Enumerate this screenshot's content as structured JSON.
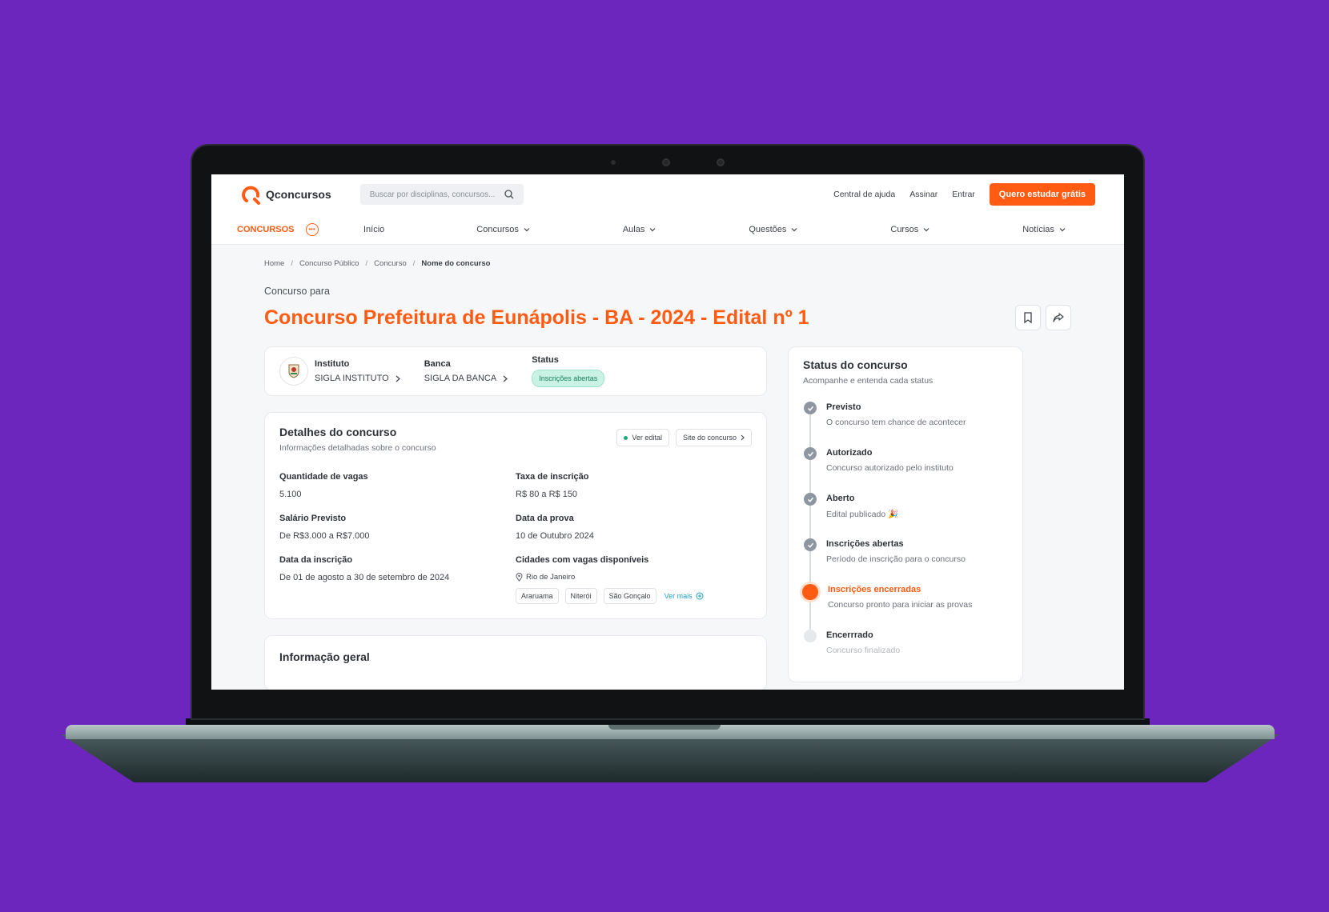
{
  "header": {
    "logo_text": "Qconcursos",
    "search_placeholder": "Buscar por disciplinas, concursos...",
    "links": [
      "Central de ajuda",
      "Assinar",
      "Entrar"
    ],
    "cta": "Quero estudar grátis"
  },
  "nav": {
    "brand": "CONCURSOS",
    "items": [
      {
        "label": "Início",
        "dropdown": false
      },
      {
        "label": "Concursos",
        "dropdown": true
      },
      {
        "label": "Aulas",
        "dropdown": true
      },
      {
        "label": "Questões",
        "dropdown": true
      },
      {
        "label": "Cursos",
        "dropdown": true
      },
      {
        "label": "Notícias",
        "dropdown": true
      }
    ]
  },
  "breadcrumb": [
    "Home",
    "Concurso Público",
    "Concurso",
    "Nome do concurso"
  ],
  "page": {
    "subtitle": "Concurso para",
    "title": "Concurso Prefeitura de Eunápolis - BA - 2024 - Edital nº 1"
  },
  "org": {
    "instituto_label": "Instituto",
    "instituto_value": "SIGLA INSTITUTO",
    "banca_label": "Banca",
    "banca_value": "SIGLA DA BANCA",
    "status_label": "Status",
    "status_value": "Inscrições abertas"
  },
  "details": {
    "title": "Detalhes do concurso",
    "subtitle": "Informações detalhadas sobre o concurso",
    "ver_edital": "Ver edital",
    "site": "Site do concurso",
    "fields": [
      {
        "label": "Quantidade de vagas",
        "value": "5.100"
      },
      {
        "label": "Taxa de inscrição",
        "value": "R$ 80 a R$ 150"
      },
      {
        "label": "Salário Previsto",
        "value": "De R$3.000 a R$7.000"
      },
      {
        "label": "Data da prova",
        "value": "10 de Outubro 2024"
      },
      {
        "label": "Data da inscrição",
        "value": "De 01 de agosto a 30 de setembro de 2024"
      }
    ],
    "cities_label": "Cidades com vagas disponíveis",
    "city_main": "Rio de Janeiro",
    "city_chips": [
      "Araruama",
      "Niterói",
      "São Gonçalo"
    ],
    "ver_mais": "Ver mais"
  },
  "info": {
    "title": "Informação geral"
  },
  "status_panel": {
    "title": "Status do concurso",
    "subtitle": "Acompanhe e entenda cada status",
    "steps": [
      {
        "title": "Previsto",
        "desc": "O concurso tem chance de acontecer",
        "state": "done"
      },
      {
        "title": "Autorizado",
        "desc": "Concurso autorizado pelo instituto",
        "state": "done"
      },
      {
        "title": "Aberto",
        "desc": "Edital publicado 🎉",
        "state": "done"
      },
      {
        "title": "Inscrições abertas",
        "desc": "Período de inscrição para o concurso",
        "state": "done"
      },
      {
        "title": "Inscrições encerradas",
        "desc": "Concurso pronto para iniciar as provas",
        "state": "active"
      },
      {
        "title": "Encerrrado",
        "desc": "Concurso finalizado",
        "state": "pending"
      }
    ]
  },
  "colors": {
    "brand": "#ff5b12",
    "background": "#6c26bd",
    "badge_bg": "#c9f2e4"
  }
}
